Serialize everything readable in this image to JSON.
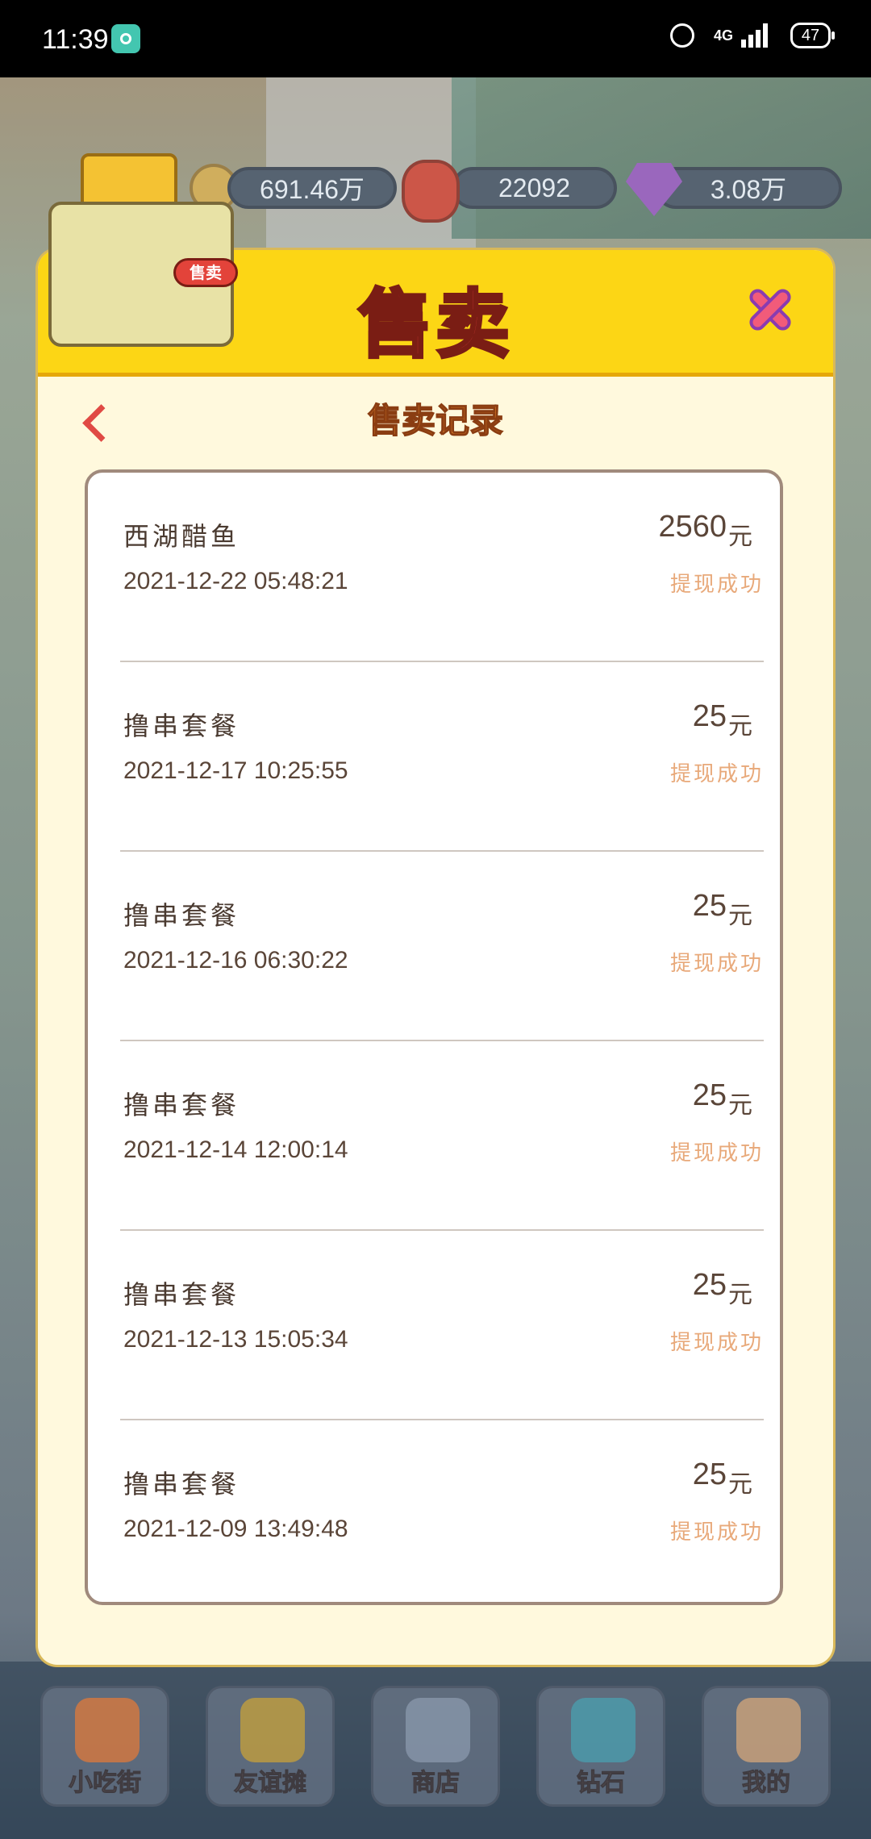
{
  "status_bar": {
    "time": "11:39",
    "network": "4G",
    "battery": "47"
  },
  "currencies": {
    "coins": "691.46万",
    "lanterns": "22092",
    "gems": "3.08万"
  },
  "shop_badge": {
    "sign": "售卖"
  },
  "modal": {
    "title": "售卖",
    "subtitle": "售卖记录"
  },
  "records": [
    {
      "name": "西湖醋鱼",
      "date": "2021-12-22 05:48:21",
      "amount": "2560",
      "unit": "元",
      "status": "提现成功"
    },
    {
      "name": "撸串套餐",
      "date": "2021-12-17 10:25:55",
      "amount": "25",
      "unit": "元",
      "status": "提现成功"
    },
    {
      "name": "撸串套餐",
      "date": "2021-12-16 06:30:22",
      "amount": "25",
      "unit": "元",
      "status": "提现成功"
    },
    {
      "name": "撸串套餐",
      "date": "2021-12-14 12:00:14",
      "amount": "25",
      "unit": "元",
      "status": "提现成功"
    },
    {
      "name": "撸串套餐",
      "date": "2021-12-13 15:05:34",
      "amount": "25",
      "unit": "元",
      "status": "提现成功"
    },
    {
      "name": "撸串套餐",
      "date": "2021-12-09 13:49:48",
      "amount": "25",
      "unit": "元",
      "status": "提现成功"
    }
  ],
  "bottom_nav": [
    {
      "label": "小吃街",
      "icon": "skewer-icon",
      "color": "#e07a3a"
    },
    {
      "label": "友谊摊",
      "icon": "stall-heart-icon",
      "color": "#c8a23a"
    },
    {
      "label": "商店",
      "icon": "store-icon",
      "color": "#8b9aad"
    },
    {
      "label": "钻石",
      "icon": "diamond-icon",
      "color": "#4aa0b0"
    },
    {
      "label": "我的",
      "icon": "avatar-icon",
      "color": "#d6a77a"
    }
  ],
  "colors": {
    "header_yellow": "#fcd615",
    "title_red": "#e8433f",
    "modal_bg": "#fff9dd",
    "status_text": "#e8a97a"
  }
}
